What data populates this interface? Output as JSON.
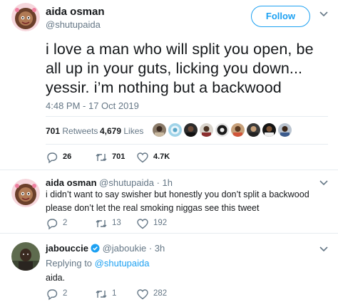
{
  "main_tweet": {
    "name": "aida osman",
    "handle": "@shutupaida",
    "follow_label": "Follow",
    "text": "i love a man who will split you open, be all up in your guts, licking you down... yessir. i’m nothing but a backwood",
    "timestamp": "4:48 PM - 17 Oct 2019",
    "retweets_count": "701",
    "retweets_label": "Retweets",
    "likes_count": "4,679",
    "likes_label": "Likes",
    "actions": {
      "replies": "26",
      "retweets": "701",
      "likes": "4.7K"
    }
  },
  "replies": [
    {
      "name": "aida osman",
      "handle": "@shutupaida · 1h",
      "text": "i didn’t want to say swisher but honestly you don’t split a backwood please don’t let the real smoking niggas see this tweet",
      "actions": {
        "replies": "2",
        "retweets": "13",
        "likes": "192"
      }
    },
    {
      "name": "jabouccie",
      "handle": "@jaboukie · 3h",
      "replying_prefix": "Replying to",
      "replying_mention": "@shutupaida",
      "text": "aida.",
      "actions": {
        "replies": "2",
        "retweets": "1",
        "likes": "282"
      }
    }
  ],
  "colors": {
    "accent": "#1da1f2",
    "secondary_text": "#657786",
    "border": "#e6ecf0",
    "verified": "#1da1f2"
  },
  "icons": [
    "caret-down-icon",
    "reply-icon",
    "retweet-icon",
    "like-icon",
    "verified-badge-icon"
  ]
}
